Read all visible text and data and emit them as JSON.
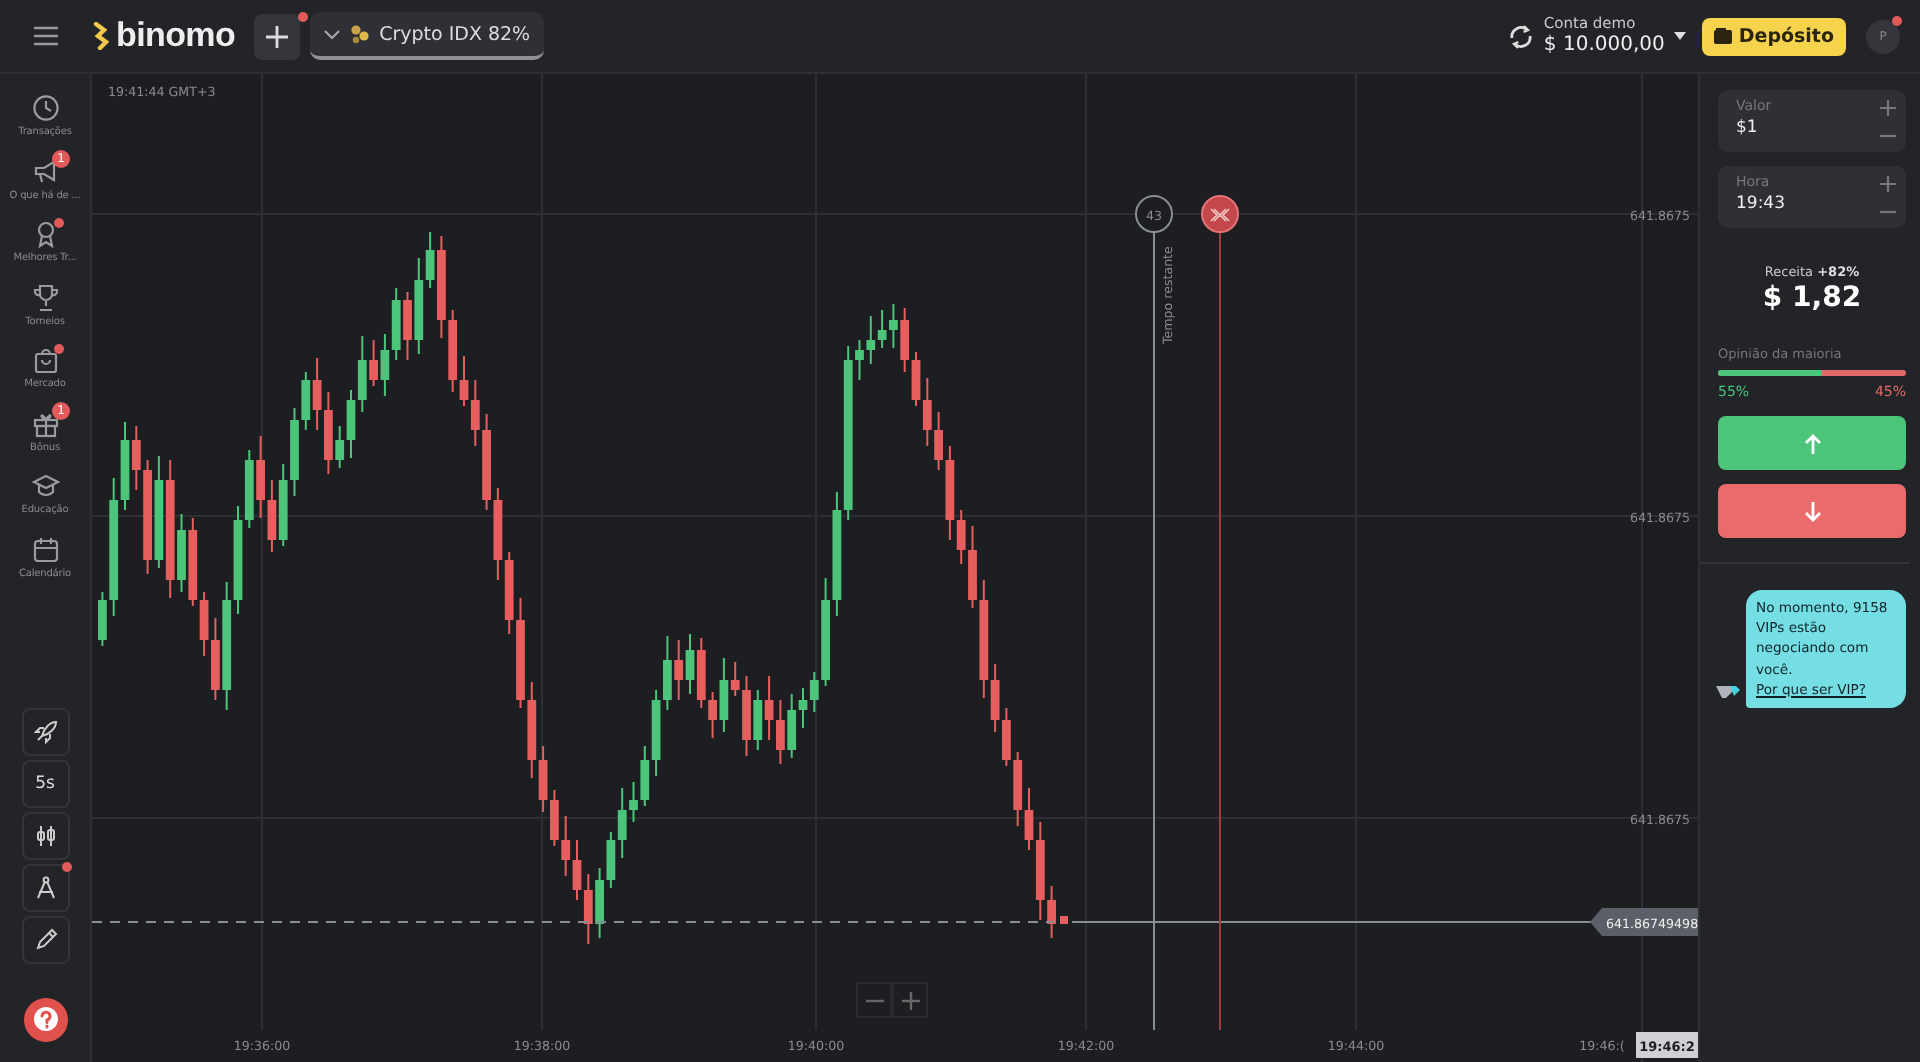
{
  "topbar": {
    "logo": "binomo",
    "new_tab_dot": true,
    "asset_tab": {
      "label": "Crypto IDX",
      "payout": "82%",
      "selected": true
    },
    "account": {
      "label": "Conta demo",
      "balance": "$ 10.000,00"
    },
    "deposit_button": "Depósito",
    "avatar": "P",
    "avatar_dot": true
  },
  "sidebar": {
    "items": [
      {
        "label": "Transações",
        "dot": false
      },
      {
        "label": "O que há de ...",
        "badge": "1",
        "dot": false
      },
      {
        "label": "Melhores Tr...",
        "dot": true
      },
      {
        "label": "Torneios",
        "dot": false
      },
      {
        "label": "Mercado",
        "dot": true
      },
      {
        "label": "Bônus",
        "badge": "1",
        "dot": false
      },
      {
        "label": "Educação",
        "dot": false
      },
      {
        "label": "Calendário",
        "dot": false
      }
    ],
    "tools": [
      {
        "dot": false
      },
      {
        "label": "5s",
        "dot": false
      },
      {
        "dot": false
      },
      {
        "dot": true
      },
      {
        "dot": false
      }
    ]
  },
  "chart": {
    "time": "19:41:44 GMT+3",
    "price_labels": [
      "641.8675",
      "641.8675",
      "641.8675"
    ],
    "time_labels": [
      "19:36:00",
      "19:38:00",
      "19:40:00",
      "19:42:00",
      "19:44:00",
      "19:46:("
    ],
    "cursor_time": "19:46:2",
    "current_price": "641.86749498",
    "countdown": "43",
    "countdown_label": "Tempo restante"
  },
  "trade_panel": {
    "amount": {
      "label": "Valor",
      "value": "$1"
    },
    "time": {
      "label": "Hora",
      "value": "19:43"
    },
    "payout_label": "Receita",
    "payout_percent": "+82%",
    "payout_value": "$ 1,82",
    "majority": {
      "label": "Opinião da maioria",
      "level": 0.55,
      "up": "55%",
      "down": "45%"
    }
  },
  "vip_message": {
    "text": "No momento, 9158 VIPs estão negociando com você. ",
    "link": "Por que ser VIP?"
  }
}
